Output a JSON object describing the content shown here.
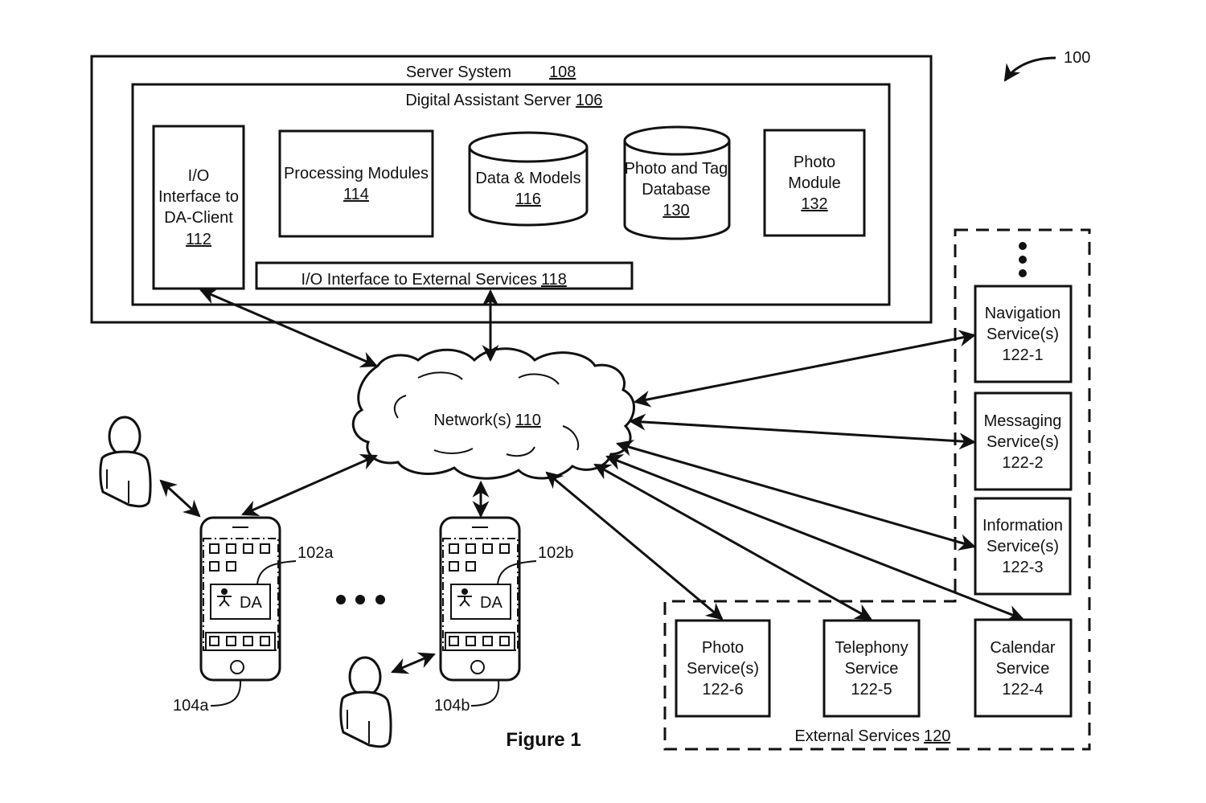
{
  "figure": {
    "caption": "Figure 1",
    "reference": "100"
  },
  "server_system": {
    "label": "Server System",
    "ref": "108",
    "da_server": {
      "label": "Digital Assistant Server",
      "ref": "106",
      "io_client": {
        "lines": [
          "I/O",
          "Interface to",
          "DA-Client"
        ],
        "ref": "112"
      },
      "processing": {
        "lines": [
          "Processing Modules"
        ],
        "ref": "114"
      },
      "data_models": {
        "lines": [
          "Data & Models"
        ],
        "ref": "116"
      },
      "photo_tag_db": {
        "lines": [
          "Photo and Tag",
          "Database"
        ],
        "ref": "130"
      },
      "photo_module": {
        "lines": [
          "Photo",
          "Module"
        ],
        "ref": "132"
      },
      "io_external": {
        "label": "I/O Interface to External Services",
        "ref": "118"
      }
    }
  },
  "network": {
    "label": "Network(s)",
    "ref": "110"
  },
  "devices": [
    {
      "device_ref": "104a",
      "client_ref": "102a",
      "app_label": "DA"
    },
    {
      "device_ref": "104b",
      "client_ref": "102b",
      "app_label": "DA"
    }
  ],
  "external_services": {
    "label": "External Services",
    "ref": "120",
    "services": [
      {
        "lines": [
          "Navigation",
          "Service(s)"
        ],
        "ref": "122-1"
      },
      {
        "lines": [
          "Messaging",
          "Service(s)"
        ],
        "ref": "122-2"
      },
      {
        "lines": [
          "Information",
          "Service(s)"
        ],
        "ref": "122-3"
      },
      {
        "lines": [
          "Calendar",
          "Service"
        ],
        "ref": "122-4"
      },
      {
        "lines": [
          "Telephony",
          "Service"
        ],
        "ref": "122-5"
      },
      {
        "lines": [
          "Photo",
          "Service(s)"
        ],
        "ref": "122-6"
      }
    ]
  }
}
